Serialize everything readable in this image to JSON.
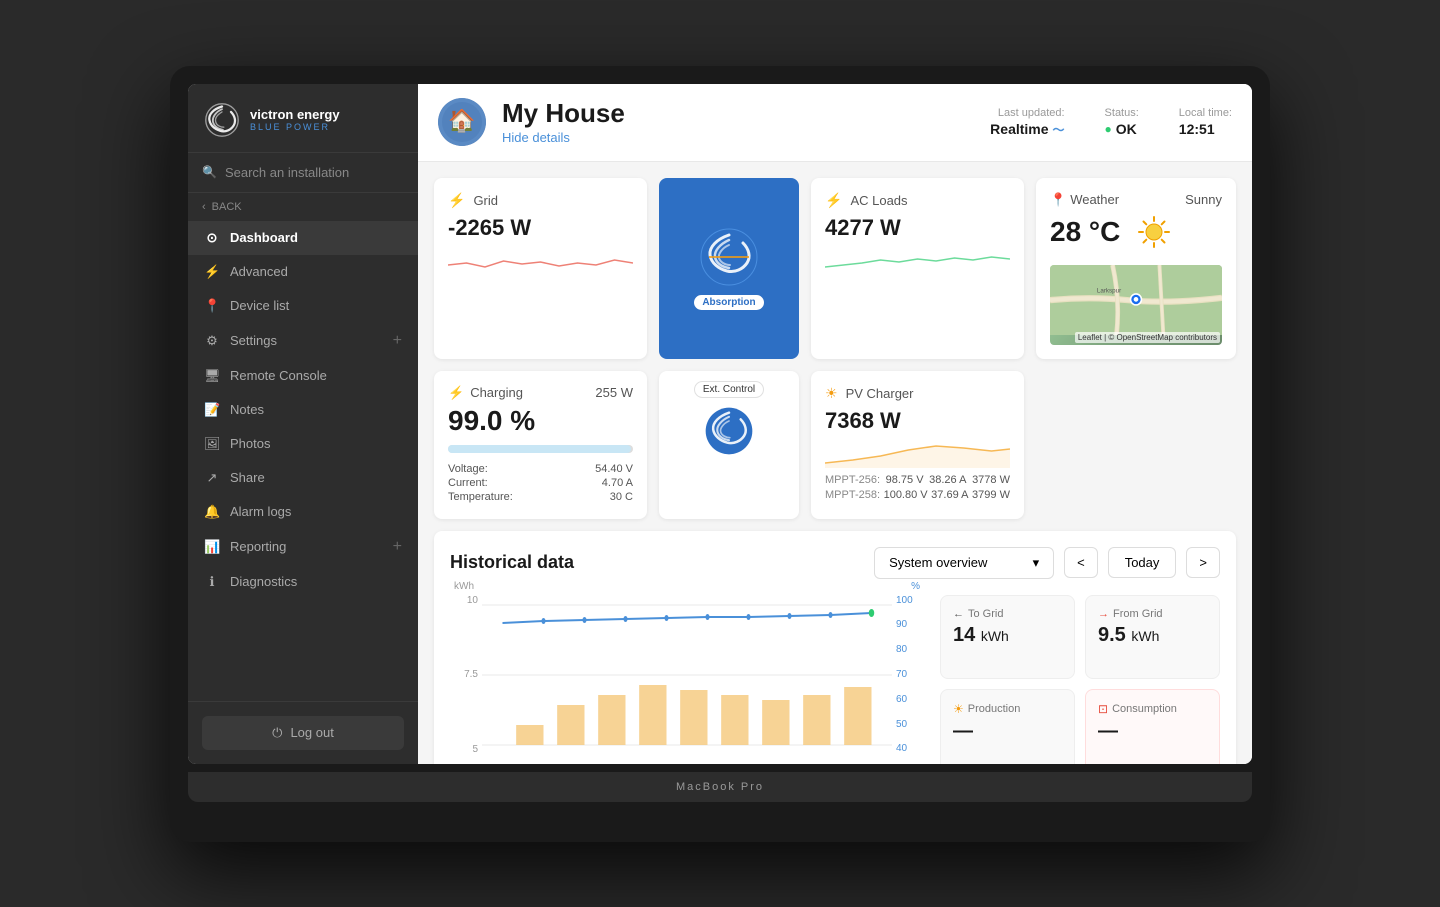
{
  "app": {
    "laptop_label": "MacBook Pro"
  },
  "sidebar": {
    "logo_text": "victron energy",
    "logo_sub": "BLUE POWER",
    "search_placeholder": "Search an installation",
    "back_label": "BACK",
    "nav_items": [
      {
        "id": "dashboard",
        "label": "Dashboard",
        "icon": "⊙",
        "active": true
      },
      {
        "id": "advanced",
        "label": "Advanced",
        "icon": "⚙"
      },
      {
        "id": "device-list",
        "label": "Device list",
        "icon": "📍"
      },
      {
        "id": "settings",
        "label": "Settings",
        "icon": "⚙",
        "has_plus": true
      },
      {
        "id": "remote-console",
        "label": "Remote Console",
        "icon": "🖥"
      },
      {
        "id": "notes",
        "label": "Notes",
        "icon": "📝"
      },
      {
        "id": "photos",
        "label": "Photos",
        "icon": "🖼"
      },
      {
        "id": "share",
        "label": "Share",
        "icon": "↗"
      },
      {
        "id": "alarm-logs",
        "label": "Alarm logs",
        "icon": "🔔"
      },
      {
        "id": "reporting",
        "label": "Reporting",
        "icon": "📊",
        "has_plus": true
      },
      {
        "id": "diagnostics",
        "label": "Diagnostics",
        "icon": "ℹ"
      }
    ],
    "logout_label": "Log out"
  },
  "header": {
    "house_name": "My House",
    "hide_details": "Hide details",
    "last_updated_label": "Last updated:",
    "last_updated_value": "Realtime",
    "status_label": "Status:",
    "status_value": "OK",
    "local_time_label": "Local time:",
    "local_time_value": "12:51"
  },
  "grid_panel": {
    "title": "Grid",
    "value": "-2265 W"
  },
  "ac_loads_panel": {
    "title": "AC Loads",
    "value": "4277 W"
  },
  "converter": {
    "absorption_label": "Absorption"
  },
  "charging_panel": {
    "title": "Charging",
    "watts": "255 W",
    "percent": "99.0 %",
    "voltage_label": "Voltage:",
    "voltage_value": "54.40 V",
    "current_label": "Current:",
    "current_value": "4.70 A",
    "temperature_label": "Temperature:",
    "temperature_value": "30 C"
  },
  "pv_charger_panel": {
    "title": "PV Charger",
    "value": "7368 W",
    "mppt1_label": "MPPT-256:",
    "mppt1_v": "98.75 V",
    "mppt1_a": "38.26 A",
    "mppt1_w": "3778 W",
    "mppt2_label": "MPPT-258:",
    "mppt2_v": "100.80 V",
    "mppt2_a": "37.69 A",
    "mppt2_w": "3799 W"
  },
  "ext_control": {
    "label": "Ext. Control"
  },
  "weather": {
    "location": "Weather",
    "condition": "Sunny",
    "temperature": "28 °C",
    "map_credit": "Leaflet | © OpenStreetMap contributors"
  },
  "historical": {
    "title": "Historical data",
    "dropdown_value": "System overview",
    "nav_prev": "<",
    "nav_next": ">",
    "today_label": "Today",
    "y_axis": [
      "10",
      "7.5",
      "5"
    ],
    "y2_axis": [
      "100",
      "90",
      "80",
      "70",
      "60",
      "50",
      "40"
    ],
    "y_label": "kWh",
    "y2_label": "%"
  },
  "stats": {
    "to_grid_label": "To Grid",
    "to_grid_value": "14",
    "to_grid_unit": "kWh",
    "from_grid_label": "From Grid",
    "from_grid_value": "9.5",
    "from_grid_unit": "kWh",
    "production_label": "Production",
    "consumption_label": "Consumption"
  }
}
